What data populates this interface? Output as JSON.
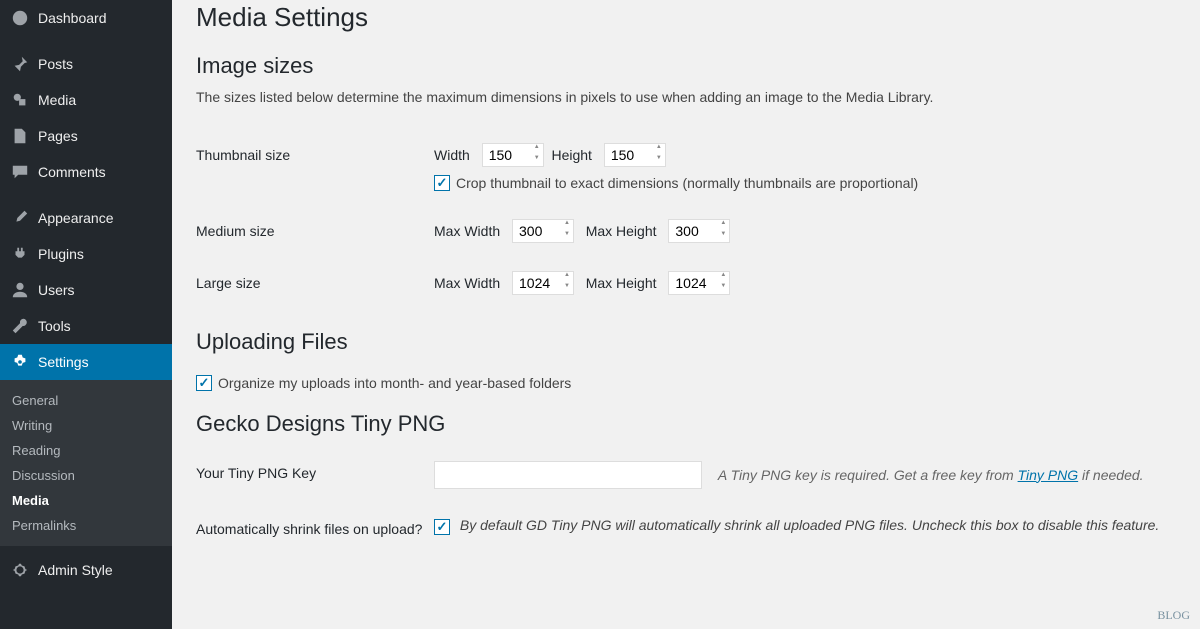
{
  "sidebar": {
    "items": [
      {
        "label": "Dashboard",
        "icon": "dashboard"
      },
      {
        "label": "Posts",
        "icon": "pin"
      },
      {
        "label": "Media",
        "icon": "media"
      },
      {
        "label": "Pages",
        "icon": "page"
      },
      {
        "label": "Comments",
        "icon": "comment"
      },
      {
        "label": "Appearance",
        "icon": "brush"
      },
      {
        "label": "Plugins",
        "icon": "plug"
      },
      {
        "label": "Users",
        "icon": "user"
      },
      {
        "label": "Tools",
        "icon": "wrench"
      },
      {
        "label": "Settings",
        "icon": "settings"
      },
      {
        "label": "Admin Style",
        "icon": "gear"
      }
    ],
    "submenu": [
      "General",
      "Writing",
      "Reading",
      "Discussion",
      "Media",
      "Permalinks"
    ]
  },
  "page": {
    "title": "Media Settings",
    "section_image_sizes": "Image sizes",
    "image_sizes_desc": "The sizes listed below determine the maximum dimensions in pixels to use when adding an image to the Media Library.",
    "thumbnail_label": "Thumbnail size",
    "width_label": "Width",
    "height_label": "Height",
    "thumb_w": "150",
    "thumb_h": "150",
    "crop_label": "Crop thumbnail to exact dimensions (normally thumbnails are proportional)",
    "medium_label": "Medium size",
    "maxw_label": "Max Width",
    "maxh_label": "Max Height",
    "med_w": "300",
    "med_h": "300",
    "large_label": "Large size",
    "large_w": "1024",
    "large_h": "1024",
    "section_upload": "Uploading Files",
    "organize_label": "Organize my uploads into month- and year-based folders",
    "section_tiny": "Gecko Designs Tiny PNG",
    "tiny_key_label": "Your Tiny PNG Key",
    "tiny_key_hint_a": "A Tiny PNG key is required. Get a free key from ",
    "tiny_key_link": "Tiny PNG",
    "tiny_key_hint_b": " if needed.",
    "auto_shrink_label": "Automatically shrink files on upload?",
    "auto_shrink_desc": "By default GD Tiny PNG will automatically shrink all uploaded PNG files. Uncheck this box to disable this feature."
  },
  "watermark": "BLOG"
}
